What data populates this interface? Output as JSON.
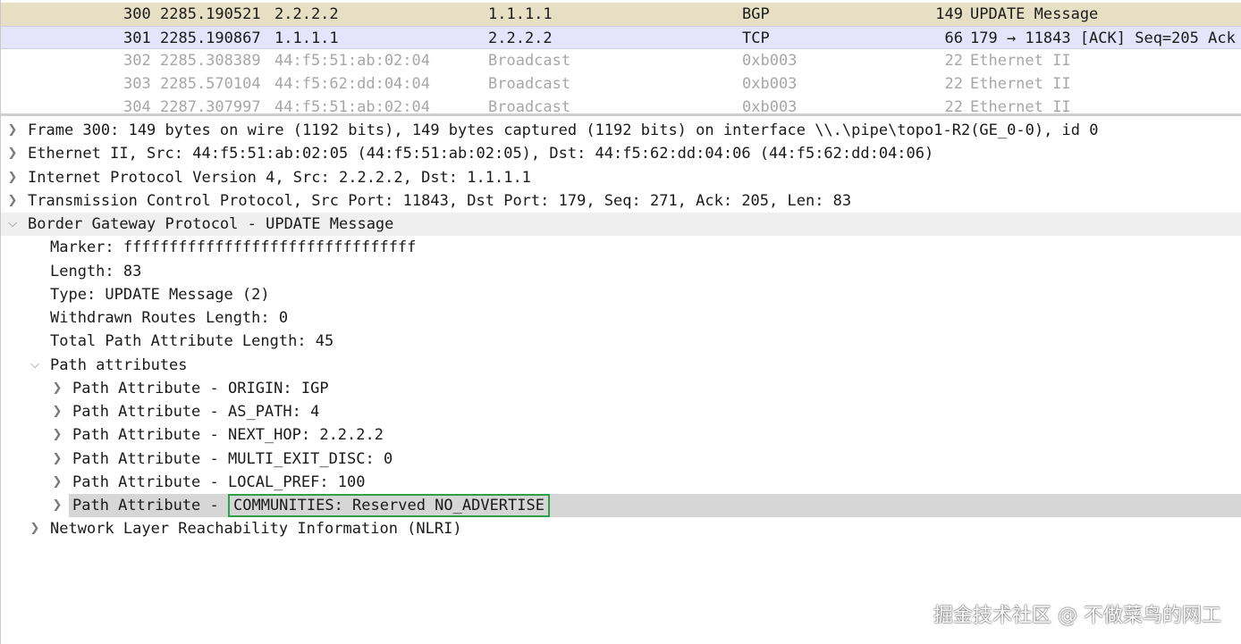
{
  "packet_list": {
    "rows": [
      {
        "no": "300",
        "time": "2285.190521",
        "src": "2.2.2.2",
        "dst": "1.1.1.1",
        "proto": "BGP",
        "len": "149",
        "info": "UPDATE Message"
      },
      {
        "no": "301",
        "time": "2285.190867",
        "src": "1.1.1.1",
        "dst": "2.2.2.2",
        "proto": "TCP",
        "len": "66",
        "info": "179 → 11843 [ACK] Seq=205 Ack"
      },
      {
        "no": "302",
        "time": "2285.308389",
        "src": "44:f5:51:ab:02:04",
        "dst": "Broadcast",
        "proto": "0xb003",
        "len": "22",
        "info": "Ethernet II"
      },
      {
        "no": "303",
        "time": "2285.570104",
        "src": "44:f5:62:dd:04:04",
        "dst": "Broadcast",
        "proto": "0xb003",
        "len": "22",
        "info": "Ethernet II"
      },
      {
        "no": "304",
        "time": "2287.307997",
        "src": "44:f5:51:ab:02:04",
        "dst": "Broadcast",
        "proto": "0xb003",
        "len": "22",
        "info": "Ethernet II"
      }
    ]
  },
  "detail_tree": {
    "frame": "Frame 300: 149 bytes on wire (1192 bits), 149 bytes captured (1192 bits) on interface \\\\.\\pipe\\topo1-R2(GE_0-0), id 0",
    "ethernet": "Ethernet II, Src: 44:f5:51:ab:02:05 (44:f5:51:ab:02:05), Dst: 44:f5:62:dd:04:06 (44:f5:62:dd:04:06)",
    "ip": "Internet Protocol Version 4, Src: 2.2.2.2, Dst: 1.1.1.1",
    "tcp": "Transmission Control Protocol, Src Port: 11843, Dst Port: 179, Seq: 271, Ack: 205, Len: 83",
    "bgp": {
      "title": "Border Gateway Protocol - UPDATE Message",
      "marker": "Marker: ffffffffffffffffffffffffffffffff",
      "length": "Length: 83",
      "type": "Type: UPDATE Message (2)",
      "withdrawn": "Withdrawn Routes Length: 0",
      "total_path_attr": "Total Path Attribute Length: 45",
      "path_attributes": {
        "title": "Path attributes",
        "items": [
          "Path Attribute - ORIGIN: IGP",
          "Path Attribute - AS_PATH: 4",
          "Path Attribute - NEXT_HOP: 2.2.2.2",
          "Path Attribute - MULTI_EXIT_DISC: 0",
          "Path Attribute - LOCAL_PREF: 100"
        ],
        "communities_prefix": "Path Attribute - ",
        "communities_value": "COMMUNITIES: Reserved NO_ADVERTISE"
      },
      "nlri": "Network Layer Reachability Information (NLRI)"
    }
  },
  "icons": {
    "collapsed": "chevron-right-icon",
    "expanded": "chevron-down-icon"
  },
  "colors": {
    "bgp_row": "#e6dfc3",
    "selected_row": "#e4e4fa",
    "highlight_box": "#2aa14a"
  },
  "watermark": "掘金技术社区 @ 不做菜鸟的网工"
}
